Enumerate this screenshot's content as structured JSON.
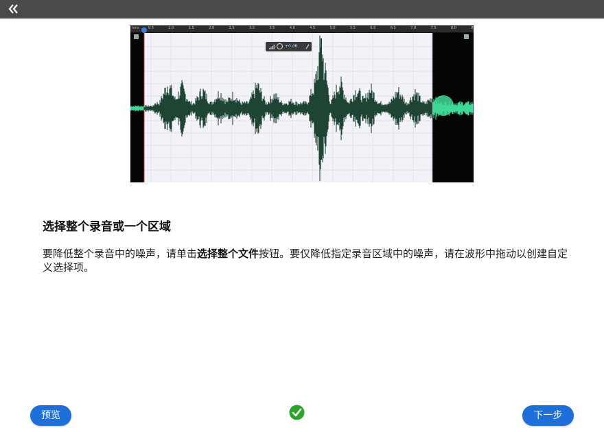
{
  "header": {
    "collapse_icon": "double-chevron-left-icon",
    "background": "#4a4a4a"
  },
  "waveform": {
    "ruler_unit": "hms",
    "ruler_labels": [
      "0.5",
      "1.0",
      "1.5",
      "2.0",
      "2.5",
      "3.0",
      "3.5",
      "4.0",
      "4.5",
      "5.0",
      "5.5",
      "6.0",
      "6.5",
      "7.0",
      "7.5",
      "8.0",
      "8.5"
    ],
    "hud": {
      "volume_value": "+0 dB"
    },
    "wave_color": "#1f4535",
    "wave_color_unselected": "#3fd896"
  },
  "content": {
    "heading": "选择整个录音或一个区域",
    "desc_part1": "要降低整个录音中的噪声，请单击",
    "desc_bold": "选择整个文件",
    "desc_part2": "按钮。要仅降低指定录音区域中的噪声，请在波形中拖动以创建自定义选择项。"
  },
  "footer": {
    "preview_label": "预览",
    "next_label": "下一步",
    "status_icon": "check-circle-icon",
    "accent": "#1f6fd8",
    "success": "#2aa52a"
  }
}
